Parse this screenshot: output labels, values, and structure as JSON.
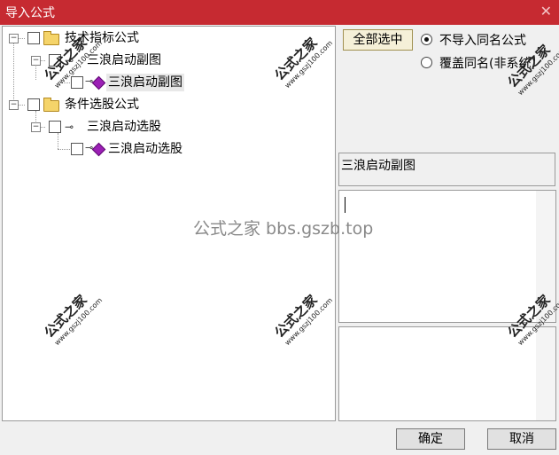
{
  "window": {
    "title": "导入公式",
    "close_glyph": "✕"
  },
  "tree": {
    "nodes": [
      {
        "label": "技术指标公式",
        "type": "folder"
      },
      {
        "label": "三浪启动副图",
        "type": "key"
      },
      {
        "label": "三浪启动副图",
        "type": "formula",
        "selected": true
      },
      {
        "label": "条件选股公式",
        "type": "folder"
      },
      {
        "label": "三浪启动选股",
        "type": "key"
      },
      {
        "label": "三浪启动选股",
        "type": "formula"
      }
    ]
  },
  "options": {
    "select_all_label": "全部选中",
    "radio_skip_label": "不导入同名公式",
    "radio_overwrite_label": "覆盖同名(非系统)"
  },
  "selected_name": "三浪启动副图",
  "buttons": {
    "ok": "确定",
    "cancel": "取消"
  },
  "watermark": {
    "brand": "公式之家",
    "url": "www.gszj100.com",
    "center": "公式之家 bbs.gszb.top"
  }
}
